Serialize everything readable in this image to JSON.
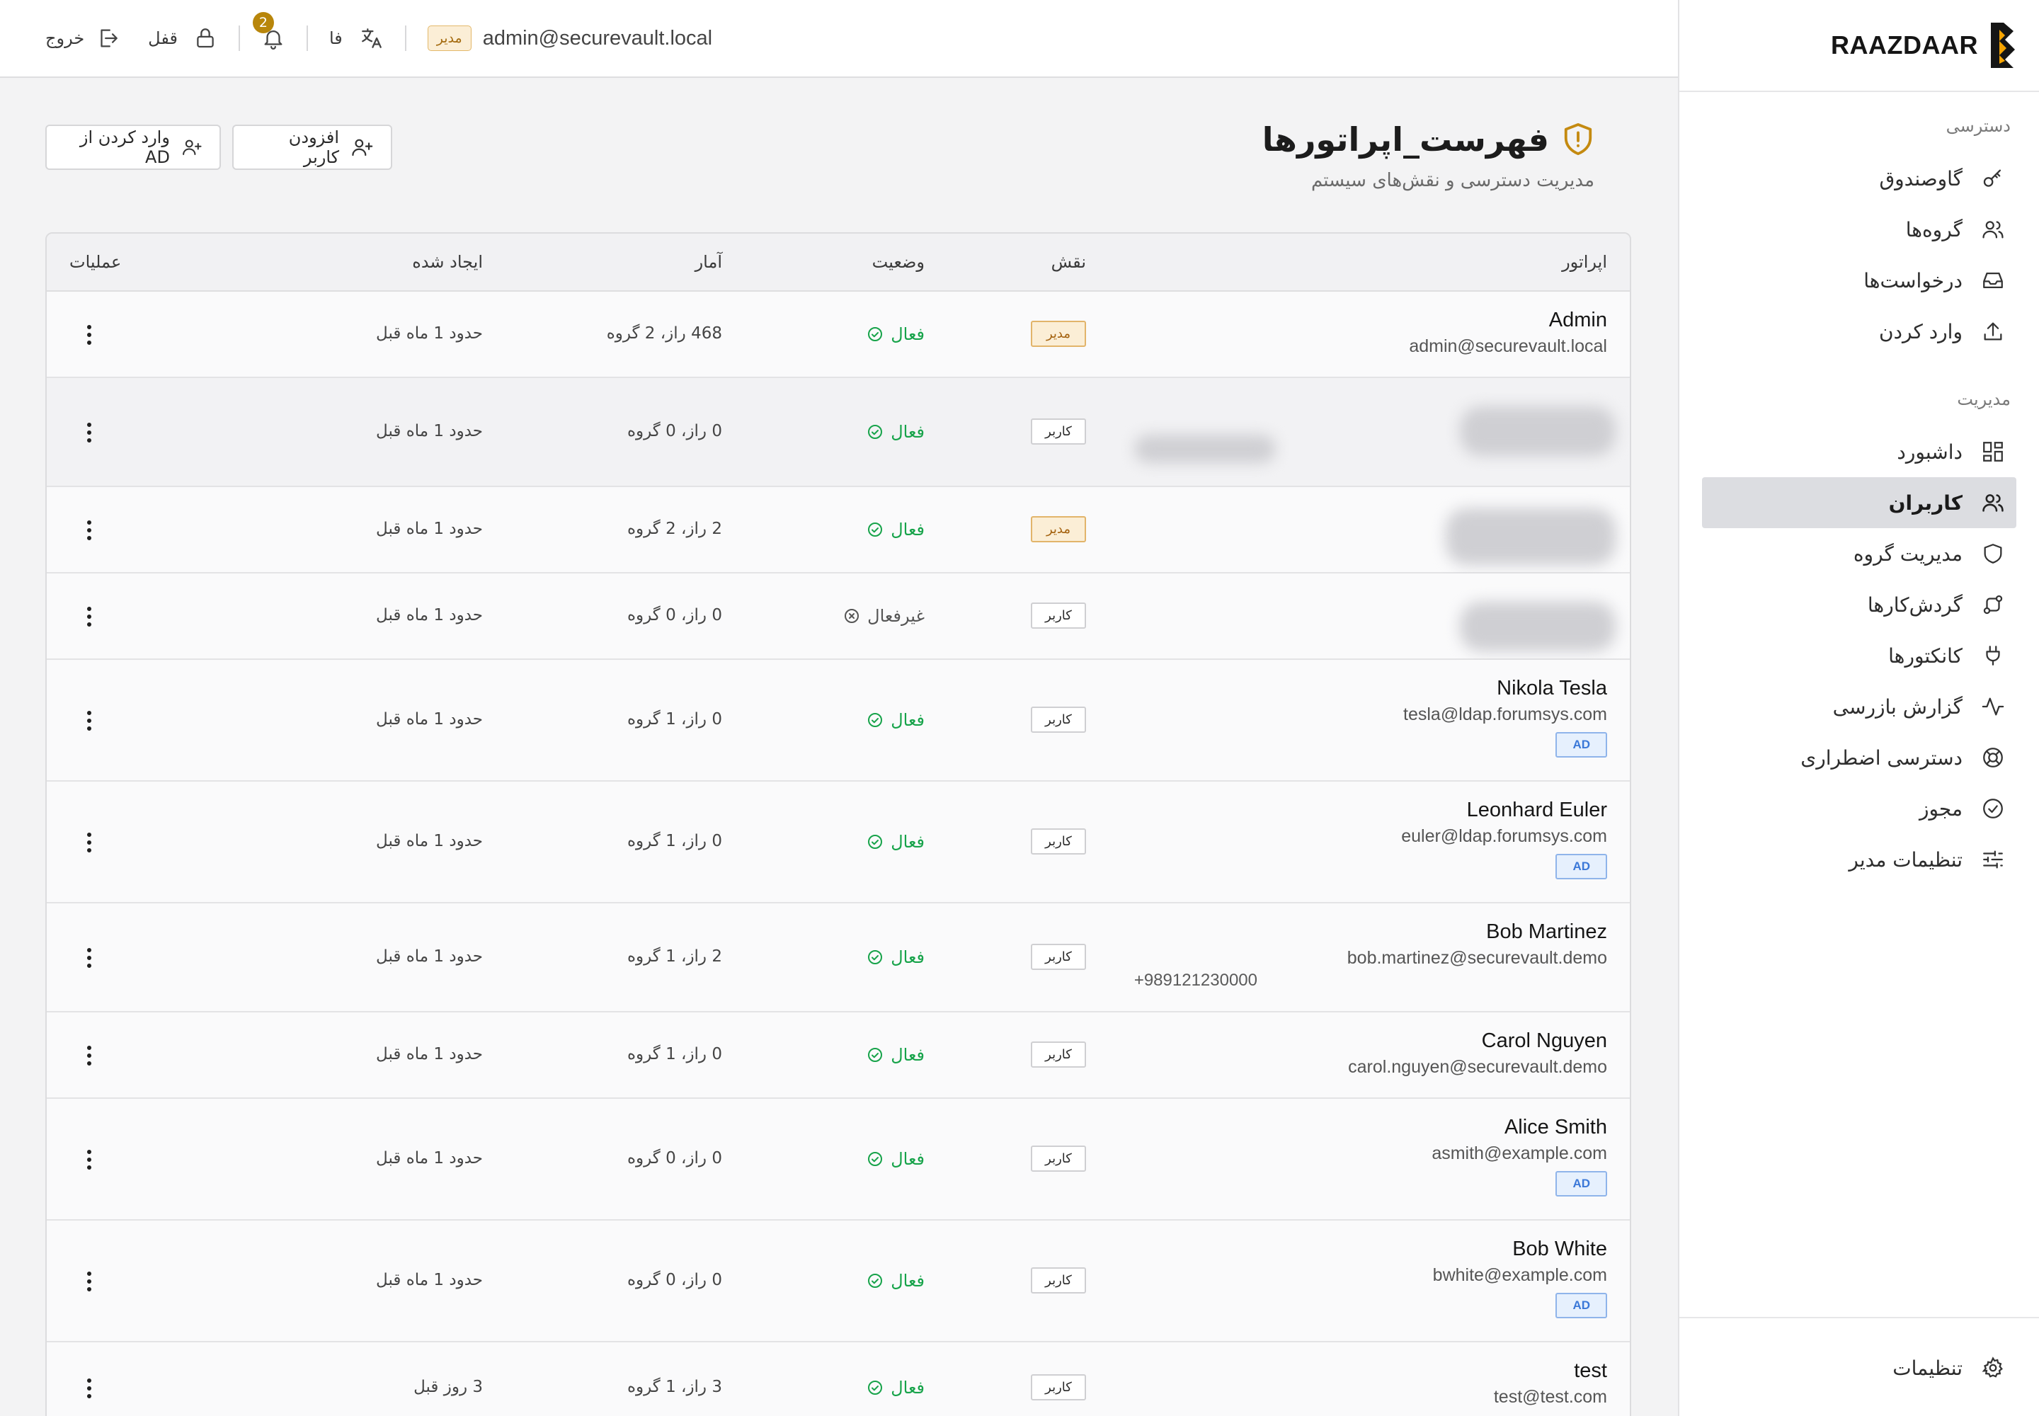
{
  "brand": {
    "name": "RAAZDAAR"
  },
  "sidebar": {
    "sections": [
      {
        "title": "دسترسی",
        "items": [
          {
            "label": "گاوصندوق",
            "icon": "key-icon"
          },
          {
            "label": "گروه‌ها",
            "icon": "users-icon"
          },
          {
            "label": "درخواست‌ها",
            "icon": "inbox-icon"
          },
          {
            "label": "وارد کردن",
            "icon": "upload-icon"
          }
        ]
      },
      {
        "title": "مدیریت",
        "items": [
          {
            "label": "داشبورد",
            "icon": "dashboard-icon"
          },
          {
            "label": "کاربران",
            "icon": "users-icon",
            "active": true
          },
          {
            "label": "مدیریت گروه",
            "icon": "shield-icon"
          },
          {
            "label": "گردش‌کارها",
            "icon": "workflow-icon"
          },
          {
            "label": "کانکتورها",
            "icon": "plug-icon"
          },
          {
            "label": "گزارش بازرسی",
            "icon": "activity-icon"
          },
          {
            "label": "دسترسی اضطراری",
            "icon": "lifebuoy-icon"
          },
          {
            "label": "مجوز",
            "icon": "check-badge-icon"
          },
          {
            "label": "تنظیمات مدیر",
            "icon": "sliders-icon"
          }
        ]
      }
    ],
    "footer": {
      "label": "تنظیمات",
      "icon": "gear-icon"
    }
  },
  "topbar": {
    "logout": "خروج",
    "lock": "قفل",
    "notifications_count": "2",
    "language": "فا",
    "role_badge": "مدیر",
    "email": "admin@securevault.local"
  },
  "page": {
    "title": "فهرست_اپراتورها",
    "subtitle": "مدیریت دسترسی و نقش‌های سیستم",
    "add_user_button": "افزودن کاربر",
    "import_ad_button": "وارد کردن از AD"
  },
  "table": {
    "columns": {
      "operator": "اپراتور",
      "role": "نقش",
      "status": "وضعیت",
      "stats": "آمار",
      "created": "ایجاد شده",
      "actions": "عملیات"
    },
    "rows": [
      {
        "name": "Admin",
        "email": "admin@securevault.local",
        "role": "مدیر",
        "role_type": "admin",
        "status": "فعال",
        "active": true,
        "stats": "468 راز، 2 گروه",
        "created": "حدود 1 ماه قبل"
      },
      {
        "name": "",
        "email": "",
        "blurred": true,
        "role": "کاربر",
        "role_type": "user",
        "status": "فعال",
        "active": true,
        "stats": "0 راز، 0 گروه",
        "created": "حدود 1 ماه قبل"
      },
      {
        "name": "",
        "email": "",
        "blurred": true,
        "role": "مدیر",
        "role_type": "admin",
        "status": "فعال",
        "active": true,
        "stats": "2 راز، 2 گروه",
        "created": "حدود 1 ماه قبل"
      },
      {
        "name": "",
        "email": "",
        "blurred": true,
        "role": "کاربر",
        "role_type": "user",
        "status": "غیرفعال",
        "active": false,
        "stats": "0 راز، 0 گروه",
        "created": "حدود 1 ماه قبل"
      },
      {
        "name": "Nikola Tesla",
        "email": "tesla@ldap.forumsys.com",
        "ad": "AD",
        "role": "کاربر",
        "role_type": "user",
        "status": "فعال",
        "active": true,
        "stats": "0 راز، 1 گروه",
        "created": "حدود 1 ماه قبل"
      },
      {
        "name": "Leonhard Euler",
        "email": "euler@ldap.forumsys.com",
        "ad": "AD",
        "role": "کاربر",
        "role_type": "user",
        "status": "فعال",
        "active": true,
        "stats": "0 راز، 1 گروه",
        "created": "حدود 1 ماه قبل"
      },
      {
        "name": "Bob Martinez",
        "email": "bob.martinez@securevault.demo",
        "phone": "+989121230000",
        "role": "کاربر",
        "role_type": "user",
        "status": "فعال",
        "active": true,
        "stats": "2 راز، 1 گروه",
        "created": "حدود 1 ماه قبل"
      },
      {
        "name": "Carol Nguyen",
        "email": "carol.nguyen@securevault.demo",
        "role": "کاربر",
        "role_type": "user",
        "status": "فعال",
        "active": true,
        "stats": "0 راز، 1 گروه",
        "created": "حدود 1 ماه قبل"
      },
      {
        "name": "Alice Smith",
        "email": "asmith@example.com",
        "ad": "AD",
        "role": "کاربر",
        "role_type": "user",
        "status": "فعال",
        "active": true,
        "stats": "0 راز، 0 گروه",
        "created": "حدود 1 ماه قبل"
      },
      {
        "name": "Bob White",
        "email": "bwhite@example.com",
        "ad": "AD",
        "role": "کاربر",
        "role_type": "user",
        "status": "فعال",
        "active": true,
        "stats": "0 راز، 0 گروه",
        "created": "حدود 1 ماه قبل"
      },
      {
        "name": "test",
        "email": "test@test.com",
        "role": "کاربر",
        "role_type": "user",
        "status": "فعال",
        "active": true,
        "stats": "3 راز، 1 گروه",
        "created": "3 روز قبل"
      }
    ]
  },
  "colors": {
    "accent": "#b8860b",
    "active_green": "#17a34a",
    "ad_blue": "#3b78d8"
  }
}
